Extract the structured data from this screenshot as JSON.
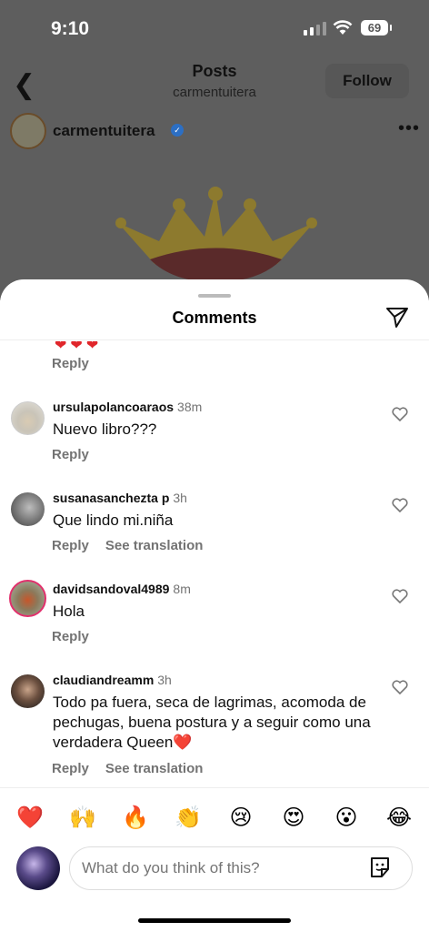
{
  "status": {
    "time": "9:10",
    "battery": "69"
  },
  "post": {
    "title": "Posts",
    "username": "carmentuitera",
    "follow_label": "Follow",
    "author": "carmentuitera"
  },
  "sheet": {
    "title": "Comments"
  },
  "comments": [
    {
      "user": "ursulapolancoaraos",
      "time": "38m",
      "text": "Nuevo libro???",
      "reply": "Reply",
      "translation": ""
    },
    {
      "user": "susanasanchezta p",
      "time": "3h",
      "text": "Que lindo mi.niña",
      "reply": "Reply",
      "translation": "See translation"
    },
    {
      "user": "davidsandoval4989",
      "time": "8m",
      "text": "Hola",
      "reply": "Reply",
      "translation": ""
    },
    {
      "user": "claudiandreamm",
      "time": "3h",
      "text": "Todo pa fuera, seca de lagrimas, acomoda de pechugas, buena postura y a seguir como una verdadera Queen❤️",
      "reply": "Reply",
      "translation": "See translation"
    }
  ],
  "first_reply": "Reply",
  "first_hearts": "❤❤❤",
  "emojis": [
    "❤️",
    "🙌",
    "🔥",
    "👏",
    "😢",
    "😍",
    "😮",
    "😂"
  ],
  "input": {
    "placeholder": "What do you think of this?"
  },
  "colors": {
    "accent": "#e0262b",
    "verified": "#2c6fc4",
    "muted": "#737373"
  }
}
